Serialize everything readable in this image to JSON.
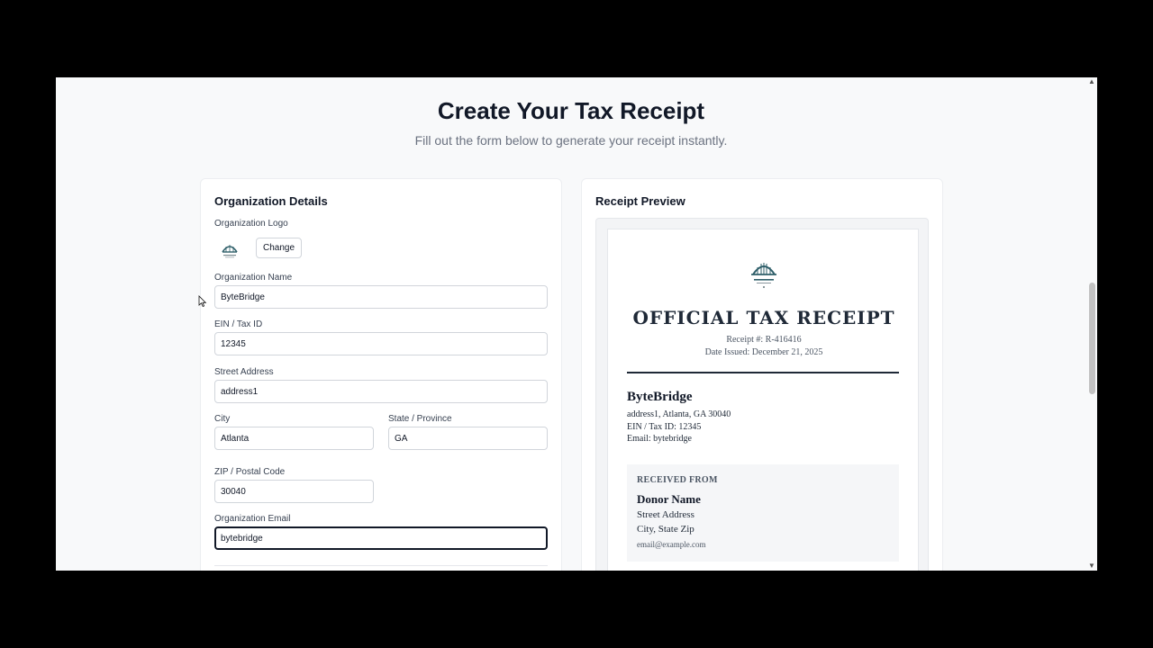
{
  "page": {
    "title": "Create Your Tax Receipt",
    "subtitle": "Fill out the form below to generate your receipt instantly."
  },
  "form": {
    "title": "Organization Details",
    "logo_label": "Organization Logo",
    "change_label": "Change",
    "fields": {
      "org_name": {
        "label": "Organization Name",
        "value": "ByteBridge"
      },
      "ein": {
        "label": "EIN / Tax ID",
        "value": "12345"
      },
      "street": {
        "label": "Street Address",
        "value": "address1"
      },
      "city": {
        "label": "City",
        "value": "Atlanta"
      },
      "state": {
        "label": "State / Province",
        "value": "GA"
      },
      "zip": {
        "label": "ZIP / Postal Code",
        "value": "30040"
      },
      "email": {
        "label": "Organization Email",
        "value": "bytebridge"
      }
    }
  },
  "preview": {
    "title": "Receipt Preview",
    "receipt": {
      "heading": "OFFICIAL TAX RECEIPT",
      "receipt_number": "Receipt #: R-416416",
      "date_issued": "Date Issued: December 21, 2025",
      "org_name": "ByteBridge",
      "org_address": "address1, Atlanta, GA 30040",
      "org_ein": "EIN / Tax ID: 12345",
      "org_email": "Email: bytebridge",
      "received_from": "RECEIVED FROM",
      "donor_name": "Donor Name",
      "donor_street": "Street Address",
      "donor_city": "City, State Zip",
      "donor_email": "email@example.com"
    }
  },
  "colors": {
    "page_bg": "#f8f9fa",
    "card_bg": "#ffffff",
    "text_primary": "#111827",
    "text_muted": "#6b7280",
    "logo_accent": "#2f5f6a"
  },
  "icons": {
    "logo": "bridge-logo-icon",
    "cursor": "mouse-pointer-icon",
    "scroll_up": "triangle-up-icon",
    "scroll_down": "triangle-down-icon"
  }
}
